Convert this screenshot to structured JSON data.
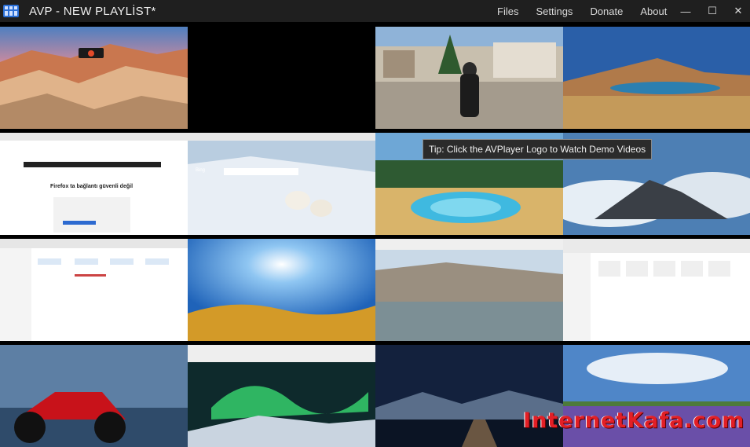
{
  "window": {
    "title": "AVP - NEW PLAYLİST*",
    "menu": [
      "Files",
      "Settings",
      "Donate",
      "About"
    ],
    "controls": {
      "minimize": "—",
      "maximize": "☐",
      "close": "✕"
    }
  },
  "tip": "Tip: Click the AVPlayer Logo to Watch Demo Videos",
  "watermark": "InternetKafa.com",
  "tiles": {
    "firefox_heading": "Firefox ta bağlantı güvenli değil",
    "bing_logo": "Bing"
  },
  "colors": {
    "titlebar_bg": "#1f1f1f",
    "watermark": "#e21f26",
    "tip_bg": "#2b2b2b"
  }
}
